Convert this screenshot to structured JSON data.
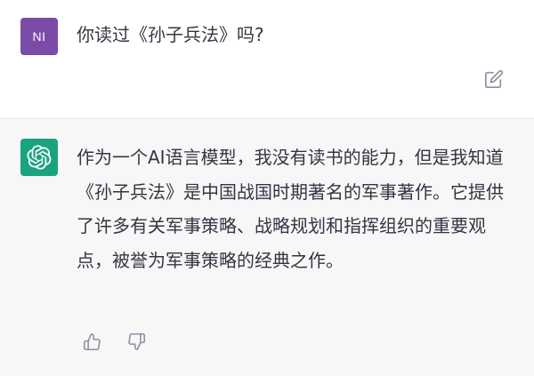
{
  "user_message": {
    "avatar_initials": "NI",
    "avatar_color": "#7b4ba8",
    "text": "你读过《孙子兵法》吗?",
    "edit_icon": "edit-icon"
  },
  "assistant_message": {
    "avatar_icon": "openai-logo-icon",
    "avatar_color": "#19a37f",
    "text": "作为一个AI语言模型，我没有读书的能力，但是我知道《孙子兵法》是中国战国时期著名的军事著作。它提供了许多有关军事策略、战略规划和指挥组织的重要观点，被誉为军事策略的经典之作。",
    "feedback_icons": [
      "thumbs-up-icon",
      "thumbs-down-icon"
    ]
  },
  "colors": {
    "user_bg": "#ffffff",
    "assistant_bg": "#f7f7f8",
    "text": "#343541",
    "icon": "#8e8ea0"
  }
}
